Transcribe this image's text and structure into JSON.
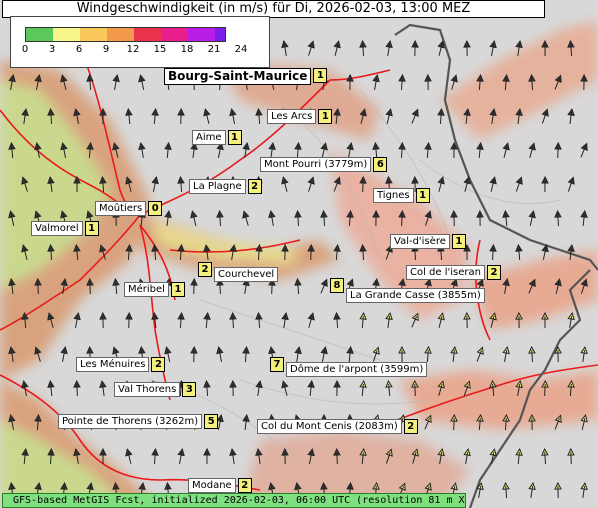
{
  "title": "Windgeschwindigkeit (in m/s) für Di, 2026-02-03, 13:00 MEZ",
  "legend": {
    "ticks": [
      "0",
      "3",
      "6",
      "9",
      "12",
      "15",
      "18",
      "21",
      "24"
    ],
    "colors": [
      "#5cc85c",
      "#f6f68a",
      "#f8c85a",
      "#f39a4a",
      "#e8334a",
      "#e81e8c",
      "#b81ee8",
      "#7a1ee8"
    ]
  },
  "places": [
    {
      "name": "Bourg-Saint-Maurice",
      "value": "1"
    },
    {
      "name": "Les Arcs",
      "value": "1"
    },
    {
      "name": "Aime",
      "value": "1"
    },
    {
      "name": "Mont Pourri (3779m)",
      "value": "6"
    },
    {
      "name": "La Plagne",
      "value": "2"
    },
    {
      "name": "Tignes",
      "value": "1"
    },
    {
      "name": "Moûtiers",
      "value": "0"
    },
    {
      "name": "Valmorel",
      "value": "1"
    },
    {
      "name": "Val-d'isère",
      "value": "1"
    },
    {
      "name": "Courchevel",
      "value": "2"
    },
    {
      "name": "Col de l'iseran",
      "value": "2"
    },
    {
      "name": "Méribel",
      "value": "1"
    },
    {
      "name": "La Grande Casse (3855m)",
      "value": "8"
    },
    {
      "name": "Les Ménuires",
      "value": "2"
    },
    {
      "name": "Dôme de l'arpont (3599m)",
      "value": "7"
    },
    {
      "name": "Val Thorens",
      "value": "3"
    },
    {
      "name": "Pointe de Thorens (3262m)",
      "value": "5"
    },
    {
      "name": "Col du Mont Cenis (2083m)",
      "value": "2"
    },
    {
      "name": "Modane",
      "value": "2"
    }
  ],
  "footer": "GFS-based MetGIS Fcst, initialized 2026-02-03, 06:00 UTC  (resolution 81 m X 115 m)"
}
